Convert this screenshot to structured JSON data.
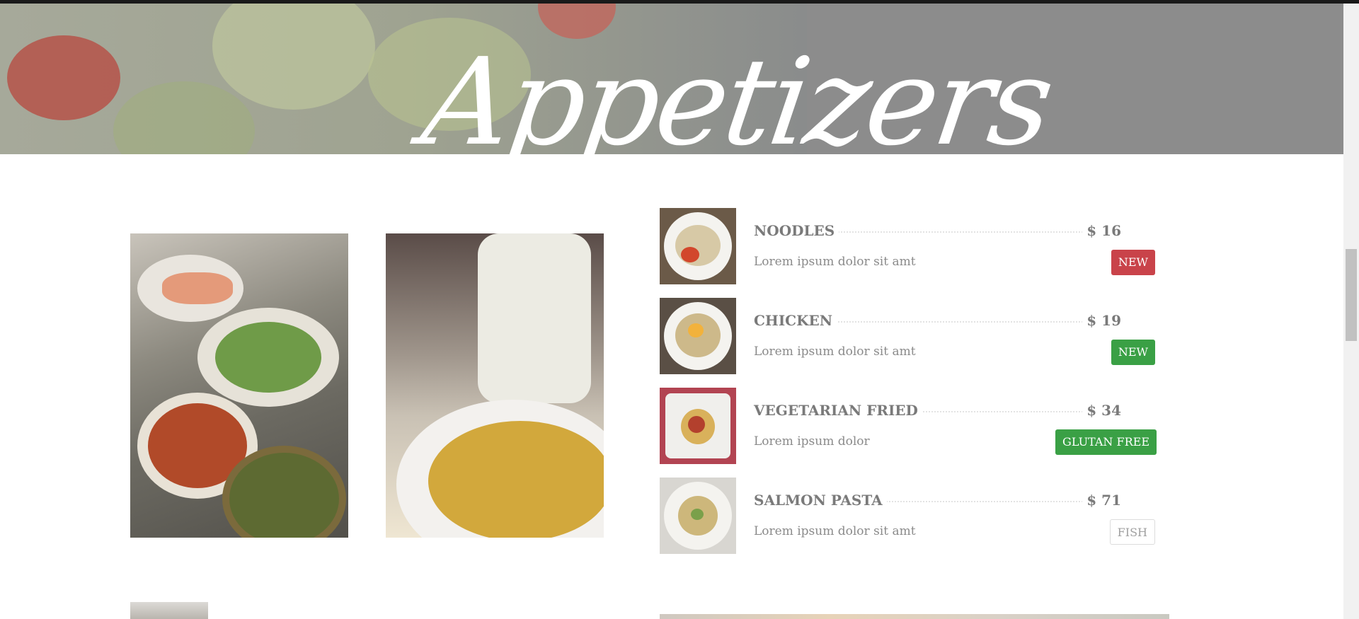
{
  "section": {
    "title": "Appetizers"
  },
  "menu": {
    "items": [
      {
        "name": "NOODLES",
        "price": "$ 16",
        "description": "Lorem ipsum dolor sit amt",
        "badge": "NEW",
        "badge_color": "#c9434a"
      },
      {
        "name": "CHICKEN",
        "price": "$ 19",
        "description": "Lorem ipsum dolor sit amt",
        "badge": "NEW",
        "badge_color": "#3aa045"
      },
      {
        "name": "VEGETARIAN FRIED",
        "price": "$ 34",
        "description": "Lorem ipsum dolor",
        "badge": "GLUTAN FREE",
        "badge_color": "#3aa045"
      },
      {
        "name": "SALMON PASTA",
        "price": "$ 71",
        "description": "Lorem ipsum dolor sit amt",
        "badge": "FISH",
        "badge_color": "#ffffff"
      }
    ]
  },
  "colors": {
    "text": "#7a7a7a",
    "badge_red": "#c9434a",
    "badge_green": "#3aa045"
  }
}
